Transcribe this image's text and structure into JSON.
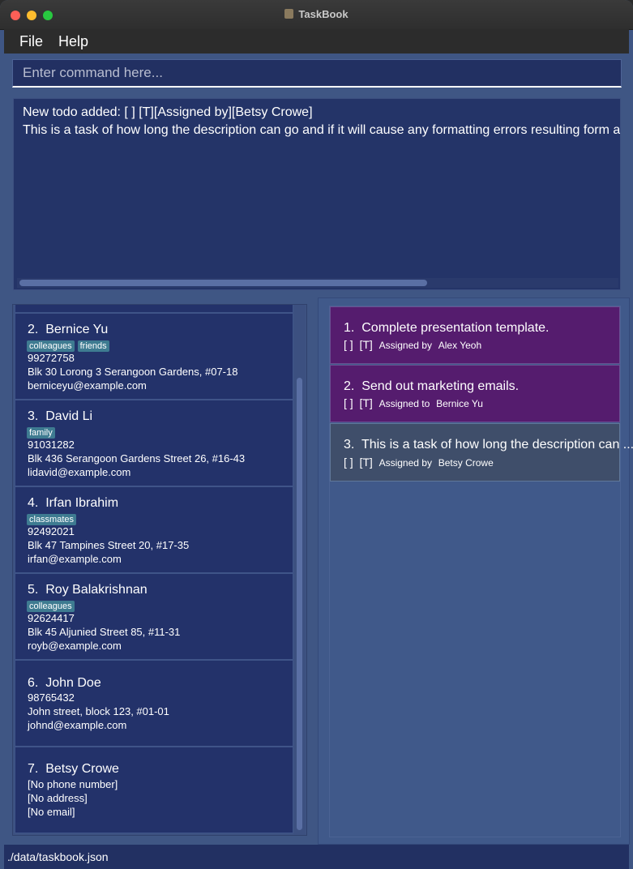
{
  "window": {
    "title": "TaskBook"
  },
  "menu": {
    "file": "File",
    "help": "Help"
  },
  "command": {
    "placeholder": "Enter command here...",
    "value": ""
  },
  "result": {
    "line1": "New todo added: [  ]  [T][Assigned by][Betsy Crowe]",
    "line2": "This is a task of how long the description can go and if it will cause any formatting errors resulting form a"
  },
  "persons": [
    {
      "index": "2.",
      "name": "Bernice Yu",
      "tags": [
        "colleagues",
        "friends"
      ],
      "phone": "99272758",
      "address": "Blk 30 Lorong 3 Serangoon Gardens, #07-18",
      "email": "berniceyu@example.com"
    },
    {
      "index": "3.",
      "name": "David Li",
      "tags": [
        "family"
      ],
      "phone": "91031282",
      "address": "Blk 436 Serangoon Gardens Street 26, #16-43",
      "email": "lidavid@example.com"
    },
    {
      "index": "4.",
      "name": "Irfan Ibrahim",
      "tags": [
        "classmates"
      ],
      "phone": "92492021",
      "address": "Blk 47 Tampines Street 20, #17-35",
      "email": "irfan@example.com"
    },
    {
      "index": "5.",
      "name": "Roy Balakrishnan",
      "tags": [
        "colleagues"
      ],
      "phone": "92624417",
      "address": "Blk 45 Aljunied Street 85, #11-31",
      "email": "royb@example.com"
    },
    {
      "index": "6.",
      "name": "John Doe",
      "tags": [],
      "phone": "98765432",
      "address": "John street, block 123, #01-01",
      "email": "johnd@example.com"
    },
    {
      "index": "7.",
      "name": "Betsy Crowe",
      "tags": [],
      "phone": "[No phone number]",
      "address": "[No address]",
      "email": "[No email]"
    }
  ],
  "tasks": [
    {
      "index": "1.",
      "title": "Complete presentation template.",
      "status": "[  ]",
      "type": "[T]",
      "relation": "Assigned by",
      "person": "Alex Yeoh"
    },
    {
      "index": "2.",
      "title": "Send out marketing emails.",
      "status": "[  ]",
      "type": "[T]",
      "relation": "Assigned to",
      "person": "Bernice Yu"
    },
    {
      "index": "3.",
      "title": "This is a task of how long the description can ...",
      "status": "[  ]",
      "type": "[T]",
      "relation": "Assigned by",
      "person": "Betsy Crowe"
    }
  ],
  "status": {
    "path": "./data/taskbook.json"
  },
  "colors": {
    "background": "#3f5684",
    "card": "#23326a",
    "tag": "#3e7b91",
    "task_purple": "#551c6e",
    "task_selected": "#3f4e6a"
  }
}
